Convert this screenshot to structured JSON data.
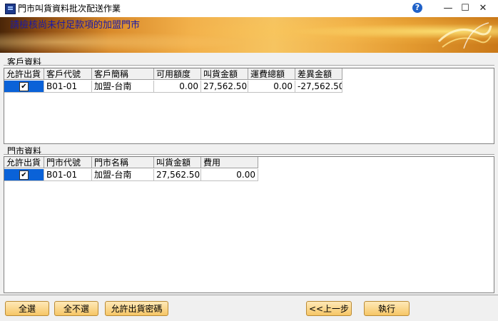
{
  "window": {
    "title": "門市叫貨資料批次配送作業",
    "help_icon": "question-circle-icon",
    "minimize_icon": "minimize-icon",
    "maximize_icon": "maximize-icon",
    "close_icon": "close-icon"
  },
  "banner": {
    "text": "請檢核尚未付足款項的加盟門市"
  },
  "customer": {
    "section_label": "客戶資料",
    "columns": [
      "允許出貨",
      "客戶代號",
      "客戶簡稱",
      "可用額度",
      "叫貨金額",
      "運費總額",
      "差異金額"
    ],
    "rows": [
      {
        "allow": "✔",
        "code": "B01-01",
        "name": "加盟-台南",
        "credit": "0.00",
        "order_amount": "27,562.50",
        "freight": "0.00",
        "difference": "-27,562.50"
      }
    ]
  },
  "store": {
    "section_label": "門市資料",
    "columns": [
      "允許出貨",
      "門市代號",
      "門市名稱",
      "叫貨金額",
      "費用"
    ],
    "rows": [
      {
        "allow": "✔",
        "code": "B01-01",
        "name": "加盟-台南",
        "order_amount": "27,562.50",
        "fee": "0.00"
      }
    ]
  },
  "buttons": {
    "select_all": "全選",
    "select_none": "全不選",
    "allow_password": "允許出貨密碼",
    "prev_step": "<<上一步",
    "execute": "執行"
  },
  "colors": {
    "selection": "#0a62d8",
    "banner_text": "#1a1aa6",
    "button_bg": "#f6c666"
  }
}
